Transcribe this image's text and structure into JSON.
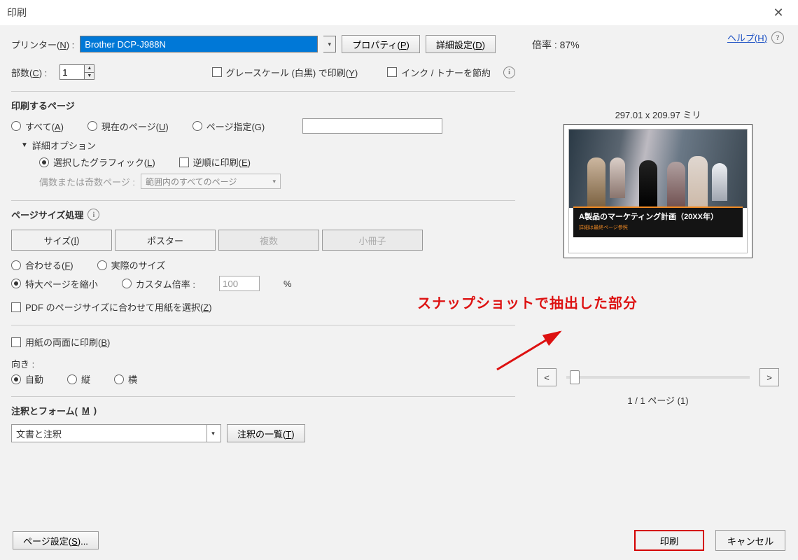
{
  "title": "印刷",
  "printer": {
    "label_prefix": "プリンター(",
    "label_mnemonic": "N",
    "label_suffix": ") :",
    "value": "Brother DCP-J988N",
    "properties_prefix": "プロパティ(",
    "properties_mnemonic": "P",
    "properties_suffix": ")",
    "advanced_prefix": "詳細設定(",
    "advanced_mnemonic": "D",
    "advanced_suffix": ")"
  },
  "help": {
    "prefix": "ヘルプ(",
    "mnemonic": "H",
    "suffix": ")"
  },
  "copies": {
    "label_prefix": "部数(",
    "mnemonic": "C",
    "suffix": ") :",
    "value": "1"
  },
  "grayscale": {
    "prefix": "グレースケール (白黒) で印刷(",
    "mnemonic": "Y",
    "suffix": ")"
  },
  "saveink": "インク / トナーを節約",
  "pages": {
    "title": "印刷するページ",
    "all_prefix": "すべて(",
    "all_mnemonic": "A",
    "all_suffix": ")",
    "current_prefix": "現在のページ(",
    "current_mnemonic": "U",
    "current_suffix": ")",
    "range_label": "ページ指定(G)",
    "more_options": "詳細オプション",
    "selected_prefix": "選択したグラフィック(",
    "selected_mnemonic": "L",
    "selected_suffix": ")",
    "reverse_prefix": "逆順に印刷(",
    "reverse_mnemonic": "E",
    "reverse_suffix": ")",
    "oddeven_label": "偶数または奇数ページ :",
    "oddeven_value": "範囲内のすべてのページ"
  },
  "sizing": {
    "title": "ページサイズ処理",
    "tabs": {
      "size_prefix": "サイズ(",
      "size_mnemonic": "I",
      "size_suffix": ")",
      "poster": "ポスター",
      "multi": "複数",
      "booklet": "小冊子"
    },
    "fit_prefix": "合わせる(",
    "fit_mnemonic": "F",
    "fit_suffix": ")",
    "actual": "実際のサイズ",
    "shrink": "特大ページを縮小",
    "custom": "カスタム倍率 :",
    "custom_value": "100",
    "percent": "%",
    "paperbypdf_prefix": "PDF のページサイズに合わせて用紙を選択(",
    "paperbypdf_mnemonic": "Z",
    "paperbypdf_suffix": ")"
  },
  "duplex": {
    "prefix": "用紙の両面に印刷(",
    "mnemonic": "B",
    "suffix": ")"
  },
  "orientation": {
    "label": "向き :",
    "auto": "自動",
    "portrait": "縦",
    "landscape": "横"
  },
  "forms": {
    "title_prefix": "注釈とフォーム(",
    "title_mnemonic": "M",
    "title_suffix": ")",
    "value": "文書と注釈",
    "list_prefix": "注釈の一覧(",
    "list_mnemonic": "T",
    "list_suffix": ")"
  },
  "footer": {
    "page_setup_prefix": "ページ設定(",
    "page_setup_mnemonic": "S",
    "page_setup_suffix": ")...",
    "print": "印刷",
    "cancel": "キャンセル"
  },
  "preview": {
    "zoom_label": "倍率 :  87%",
    "dims": "297.01 x 209.97 ミリ",
    "caption1": "A製品のマーケティング計画（20XX年）",
    "caption2": "詳細は最終ページ参照",
    "annotation": "スナップショットで抽出した部分",
    "prev": "<",
    "next": ">",
    "page_info": "1 / 1 ページ (1)"
  }
}
